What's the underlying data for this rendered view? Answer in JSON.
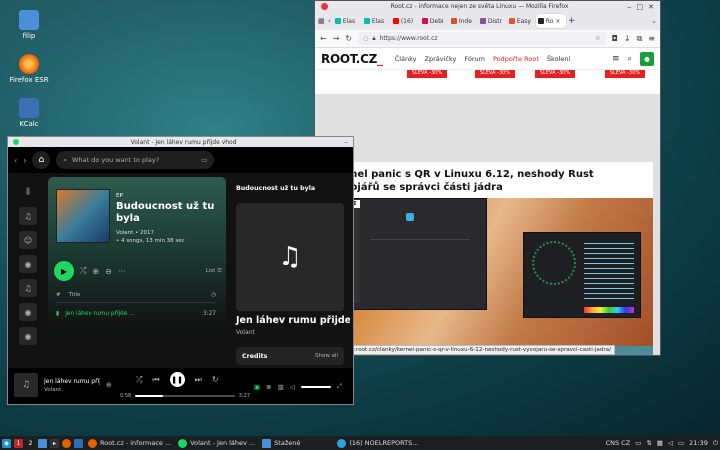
{
  "desktop": {
    "icons": [
      {
        "label": "filip",
        "color": "#4a90d9"
      },
      {
        "label": "Firefox ESR",
        "color": "#e66000"
      },
      {
        "label": "KCalc",
        "color": "#3c6fb4"
      }
    ]
  },
  "firefox": {
    "title": "Root.cz - informace nejen ze světa Linuxu — Mozilla Firefox",
    "tabs": [
      {
        "label": "Elas",
        "color": "#00bfb3"
      },
      {
        "label": "Elas",
        "color": "#00bfb3"
      },
      {
        "label": "(16)",
        "color": "#ff0000"
      },
      {
        "label": "Debi",
        "color": "#d70a53"
      },
      {
        "label": "Inde",
        "color": "#e34c26"
      },
      {
        "label": "Distr",
        "color": "#8c4a9e"
      },
      {
        "label": "Easy",
        "color": "#e95420"
      },
      {
        "label": "Ro",
        "color": "#222222"
      }
    ],
    "url": "https://www.root.cz",
    "site": {
      "logo_main": "ROOT.CZ",
      "logo_accent": "_",
      "nav": [
        "Články",
        "Zprávičky",
        "Fórum",
        "Podpořte Root",
        "Školení"
      ],
      "ads": [
        "SLEVA -30%",
        "SLEVA -30%",
        "SLEVA -30%",
        "SLEVA -30%"
      ],
      "headline": "Kernel panic s QR v Linuxu 6.12, neshody Rust vývojářů se správci části jádra",
      "badge": "STALO SE",
      "status_url": "https://www.root.cz/clanky/kernel-panic-s-qr-v-linuxu-6-12-neshody-rust-vyvojaru-se-spravci-casti-jadra/"
    }
  },
  "spotify": {
    "title": "Volant - Jen láhev rumu příjde vhod",
    "search_placeholder": "What do you want to play?",
    "album": {
      "type": "EP",
      "title": "Budoucnost už tu byla",
      "artist_year": "Volant • 2017",
      "songs": "• 4 songs, 13 min 38 sec"
    },
    "list_label": "List",
    "column_title": "Title",
    "column_num": "#",
    "track": {
      "name": "Jen láhev rumu příjde ...",
      "duration": "3:27"
    },
    "panel": {
      "title": "Budoucnost už tu byla",
      "song": "Jen láhev rumu přijde",
      "artist": "Volant",
      "credits": "Credits",
      "show_all": "Show all"
    },
    "now_playing": {
      "title": "Jen láhev rumu příjde",
      "artist": "Volant",
      "elapsed": "0:58",
      "total": "3:27",
      "progress": 0.28
    }
  },
  "taskbar": {
    "workspaces": [
      "1",
      "2"
    ],
    "tasks": [
      "Root.cz - informace ...",
      "Volant - Jen láhev ...",
      "Stažené",
      "(16) NOELREPORTS..."
    ],
    "tray_text": "CNS CZ",
    "clock": "21:39"
  }
}
